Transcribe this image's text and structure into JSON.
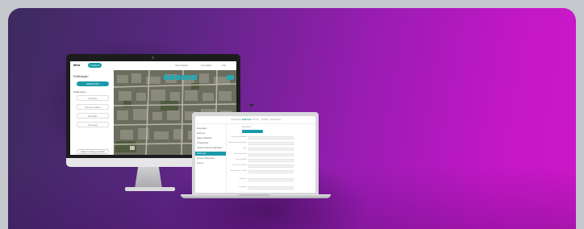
{
  "colors": {
    "accent": "#1a9aa8",
    "background_start": "#3c2a5e",
    "background_end": "#cc18c8",
    "page_border": "#c4c8cc"
  },
  "monitor": {
    "logo": "Mira",
    "pill": "Ir Mundo",
    "menu": [
      "Informações",
      "Consultas",
      "Sair"
    ],
    "back": "Edificação",
    "blue_button": "GERAR BCI",
    "section_label": "Parâmetros",
    "selects": [
      "Fracção",
      "Tipo de edificio",
      "Situação",
      "Tipologia"
    ],
    "bottom_button": "Salvar e prosseguir edição"
  },
  "laptop": {
    "tabs": [
      {
        "label": "Informações",
        "active": false
      },
      {
        "label": "Edificação",
        "active": true
      },
      {
        "label": "Terreno",
        "active": false
      },
      {
        "label": "Registro",
        "active": false
      },
      {
        "label": "Documentos",
        "active": false
      }
    ],
    "menu": [
      {
        "label": "Proprietário",
        "active": false
      },
      {
        "label": "Endereço",
        "active": false
      },
      {
        "label": "Dados cadastrais",
        "active": false
      },
      {
        "label": "Infraestrutura",
        "active": false
      },
      {
        "label": "Características da edificação",
        "active": false
      },
      {
        "label": "Pavimento",
        "active": true
      },
      {
        "label": "Serviços Disponíveis",
        "active": false
      },
      {
        "label": "Anexos",
        "active": false
      }
    ],
    "form_header": "Edificação",
    "fields": [
      "Inscrição imobiliária",
      "Número de pavimentos",
      "Área",
      "Área construída",
      "Tipo de padrão",
      "Tipo de construção",
      "Estado conservação",
      "Utilização",
      "Ocupação"
    ]
  }
}
